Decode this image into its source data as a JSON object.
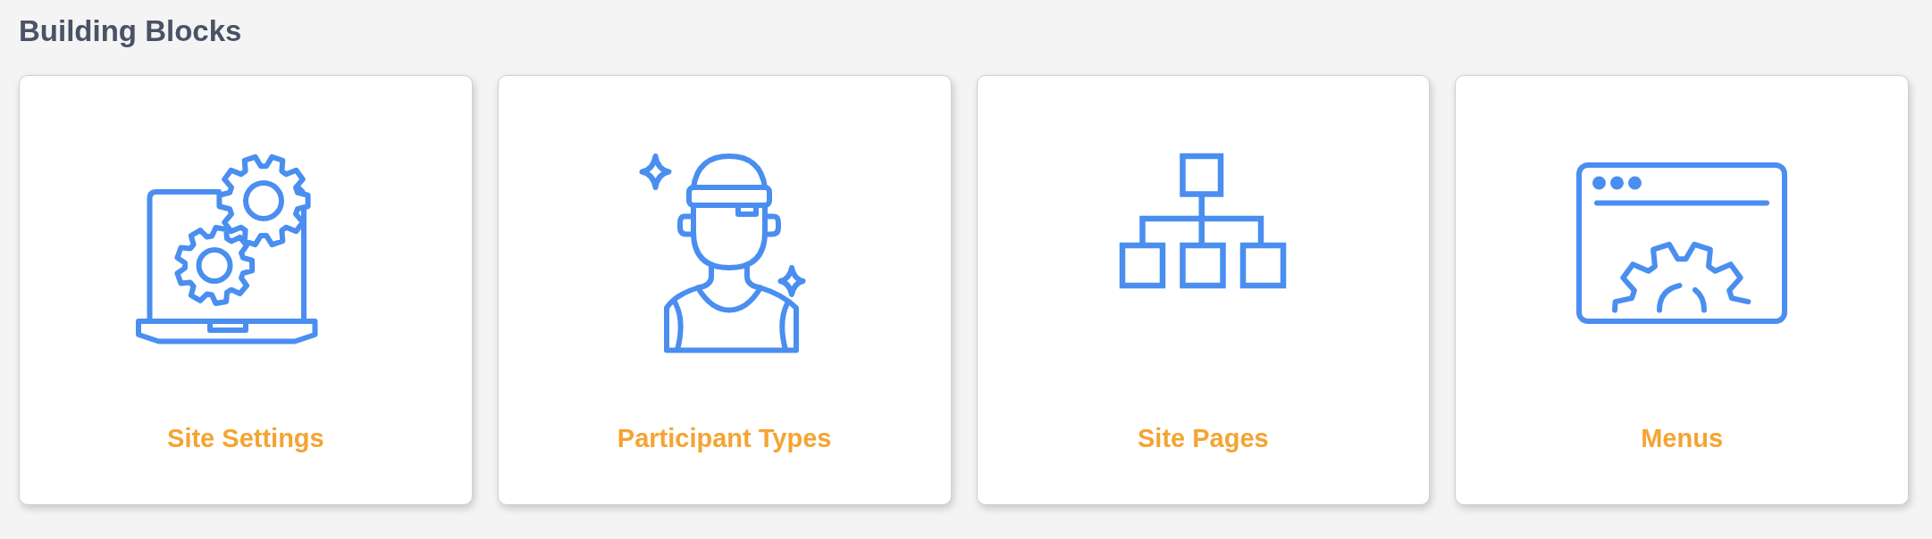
{
  "title": "Building Blocks",
  "cards": [
    {
      "label": "Site Settings",
      "kind": "settings"
    },
    {
      "label": "Participant Types",
      "kind": "participants"
    },
    {
      "label": "Site Pages",
      "kind": "pages"
    },
    {
      "label": "Menus",
      "kind": "menus"
    }
  ]
}
